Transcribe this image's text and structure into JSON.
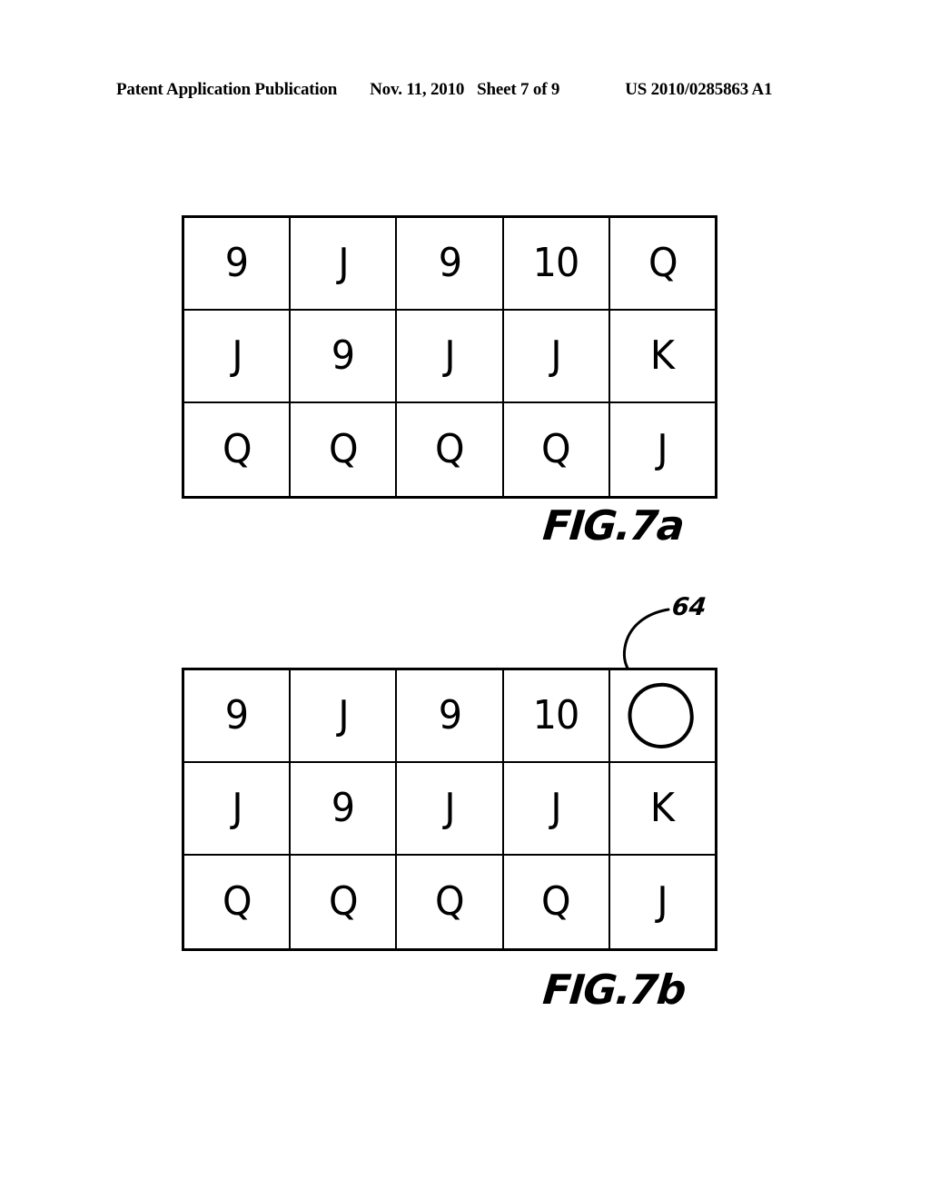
{
  "header": {
    "publication": "Patent Application Publication",
    "date": "Nov. 11, 2010",
    "sheet": "Sheet 7 of 9",
    "document_number": "US 2010/0285863 A1"
  },
  "figures": [
    {
      "id": "7a",
      "caption": "FIG.7a",
      "grid": {
        "rows": 3,
        "columns": 5,
        "cells": [
          [
            "9",
            "J",
            "9",
            "10",
            "Q"
          ],
          [
            "J",
            "9",
            "J",
            "J",
            "K"
          ],
          [
            "Q",
            "Q",
            "Q",
            "Q",
            "J"
          ]
        ]
      }
    },
    {
      "id": "7b",
      "caption": "FIG.7b",
      "callout": {
        "label": "64",
        "icon": "leader-line-icon",
        "points_to": "marker-circle at row 1, column 5"
      },
      "grid": {
        "rows": 3,
        "columns": 5,
        "cells": [
          [
            "9",
            "J",
            "9",
            "10",
            ""
          ],
          [
            "J",
            "9",
            "J",
            "J",
            "K"
          ],
          [
            "Q",
            "Q",
            "Q",
            "Q",
            "J"
          ]
        ],
        "marked_cell": {
          "row": 1,
          "column": 5,
          "marker": "circle"
        }
      }
    }
  ],
  "colors": {
    "ink": "#000000",
    "paper": "#ffffff"
  }
}
